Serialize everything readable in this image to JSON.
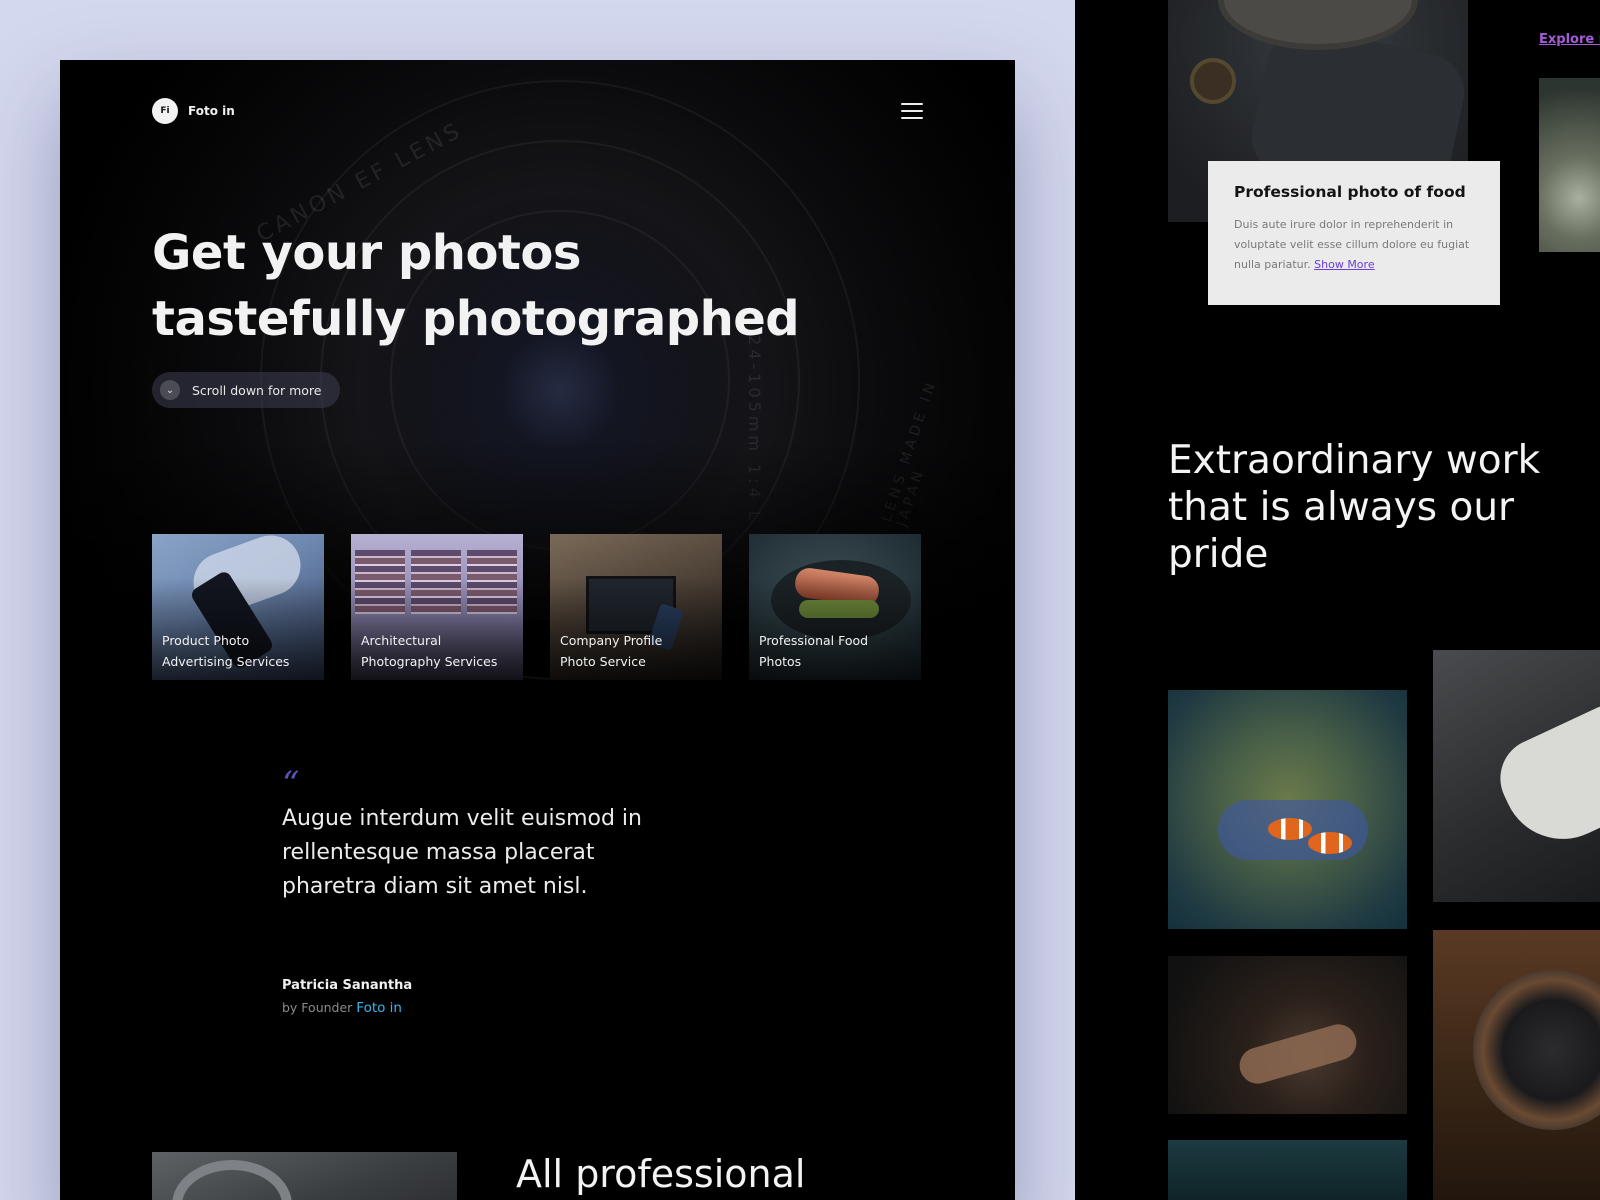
{
  "left": {
    "nav": {
      "logo_mark": "Fi",
      "logo_text": "Foto in"
    },
    "hero": {
      "title_line1": "Get your photos",
      "title_line2": "tastefully photographed",
      "lens_text_1": "CANON EF LENS",
      "lens_text_2": "24-105mm 1:4 L",
      "lens_text_3": "LENS MADE IN JAPAN",
      "scroll_label": "Scroll down for more"
    },
    "services": [
      {
        "line1": "Product Photo",
        "line2": "Advertising Services"
      },
      {
        "line1": "Architectural",
        "line2": "Photography Services"
      },
      {
        "line1": "Company Profile",
        "line2": "Photo Service"
      },
      {
        "line1": "Professional Food",
        "line2": "Photos"
      }
    ],
    "testimonial": {
      "quote_mark": "“",
      "text": "Augue interdum velit euismod in rellentesque massa placerat pharetra diam sit amet nisl.",
      "author": "Patricia Sanantha",
      "role_prefix": "by Founder",
      "role_brand": "Foto in"
    },
    "bottom_title": "All professional"
  },
  "right": {
    "explore_link": "Explore m",
    "food_card": {
      "title": "Professional photo of food",
      "desc": "Duis aute irure dolor in reprehenderit in voluptate velit esse cillum dolore eu fugiat nulla pariatur.",
      "link": "Show More"
    },
    "work_title": "Extraordinary work that is always our pride"
  },
  "colors": {
    "background": "#d4d8ee",
    "surface": "#000000",
    "accent_blue": "#36b6ea",
    "accent_purple": "#6a3bd8",
    "quote_mark": "#5a56b8"
  },
  "icons": {
    "menu": "hamburger-icon",
    "scroll": "chevron-down-icon"
  }
}
